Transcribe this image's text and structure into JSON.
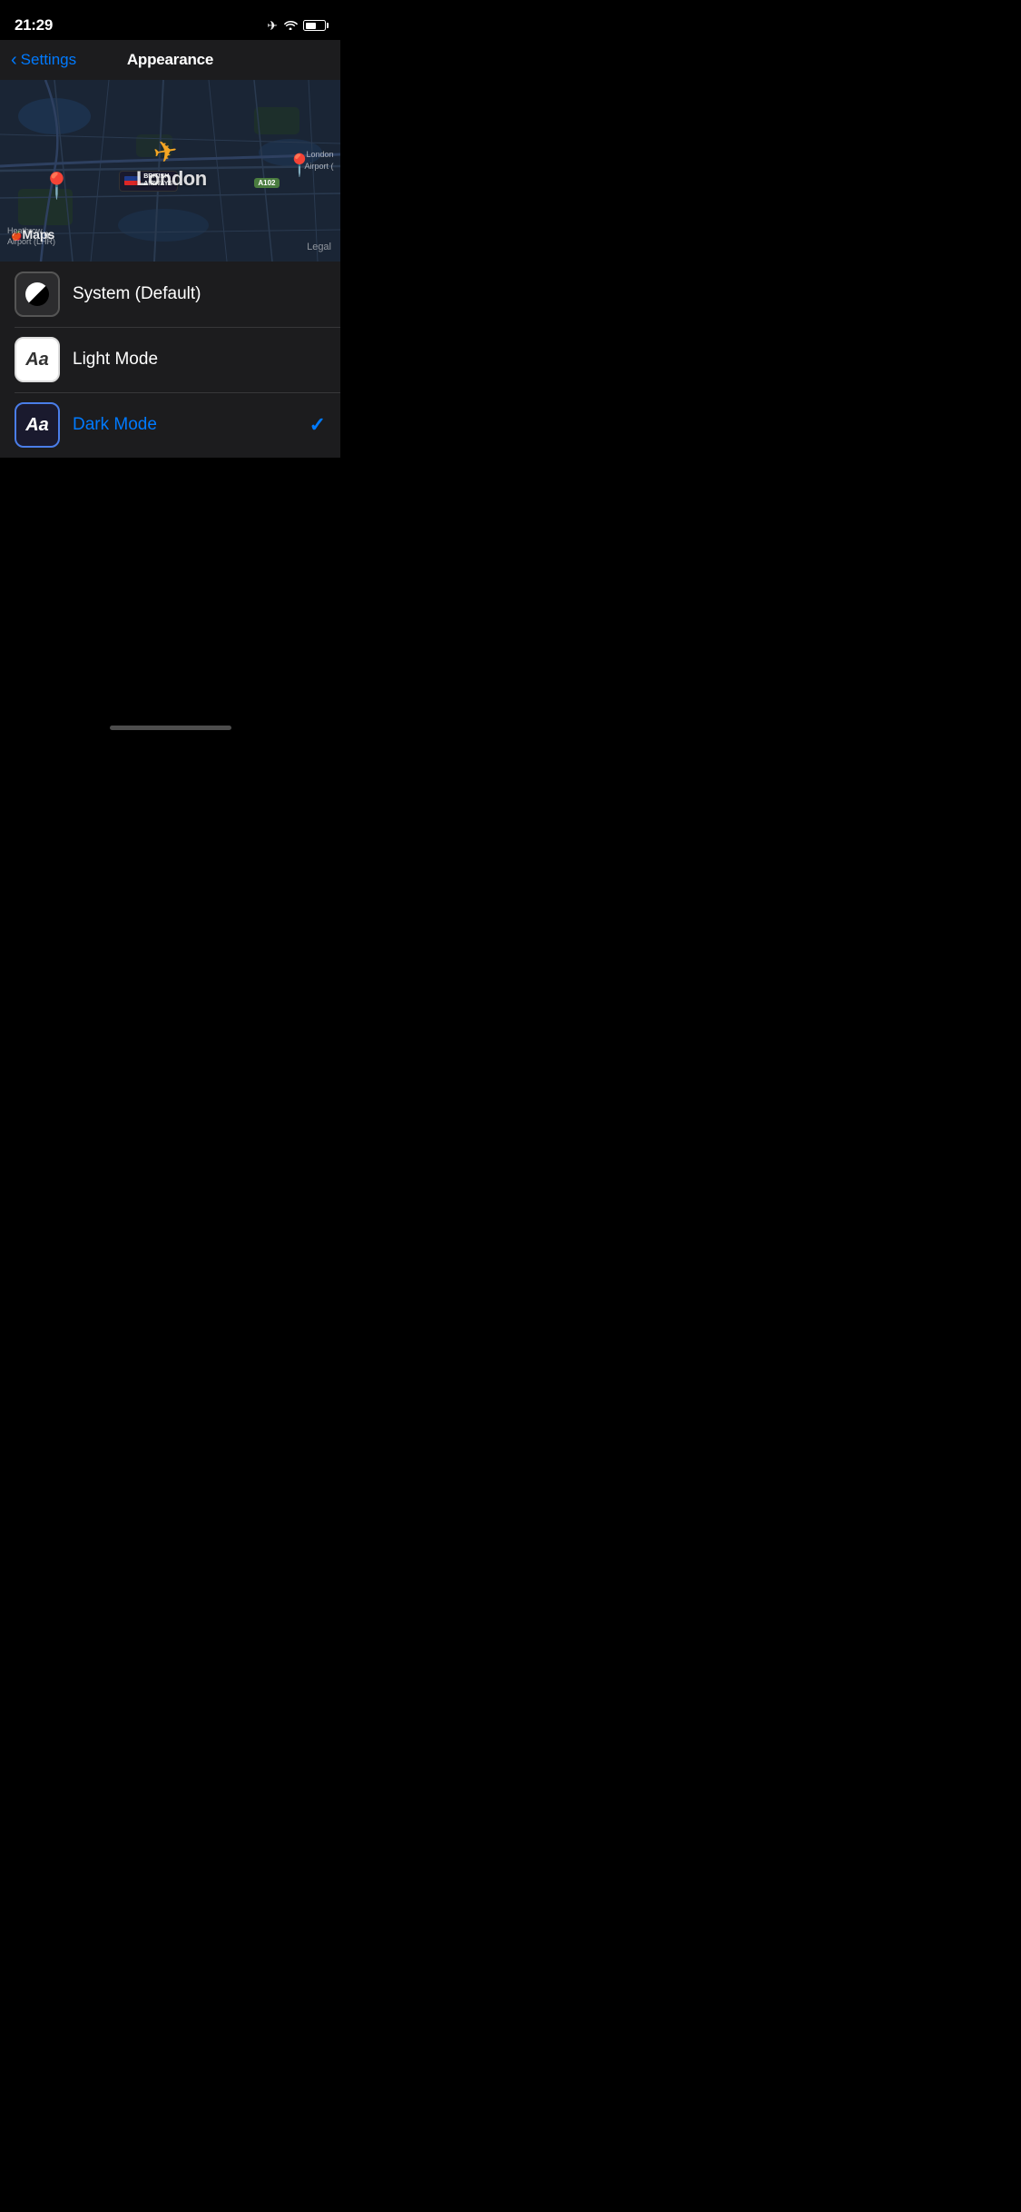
{
  "statusBar": {
    "time": "21:29"
  },
  "navBar": {
    "backLabel": "Settings",
    "title": "Appearance"
  },
  "map": {
    "londonLabel": "London",
    "mapsLabel": "Maps",
    "legalLabel": "Legal",
    "heathrowLabel": "Heathrow\nAirport (LHR)",
    "londonAirportLabel": "London\nAirport (",
    "a102Label": "A102",
    "baTextLine1": "BRITISH",
    "baTextLine2": "AIRWAYS"
  },
  "options": [
    {
      "id": "system",
      "label": "System (Default)",
      "iconType": "system",
      "selected": false
    },
    {
      "id": "light",
      "label": "Light Mode",
      "iconType": "light",
      "selected": false
    },
    {
      "id": "dark",
      "label": "Dark Mode",
      "iconType": "dark",
      "selected": true
    }
  ],
  "homeIndicator": {
    "ariaLabel": "Home Indicator"
  }
}
